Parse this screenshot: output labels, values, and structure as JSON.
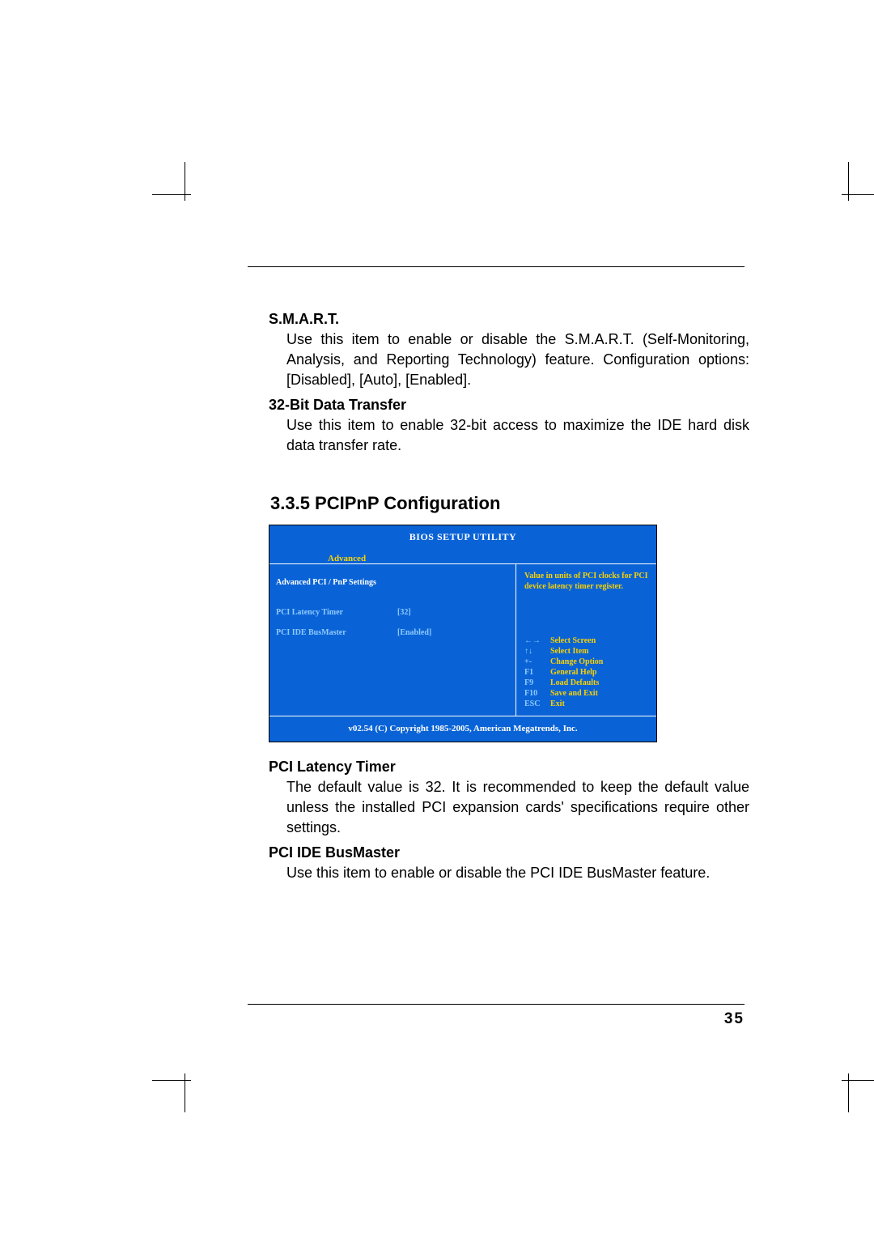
{
  "smart": {
    "title": "S.M.A.R.T.",
    "body": "Use this item to enable or disable the S.M.A.R.T. (Self-Monitoring, Analysis, and Reporting Technology) feature. Configuration options: [Disabled], [Auto], [Enabled]."
  },
  "bit32": {
    "title": "32-Bit Data Transfer",
    "body": "Use this item to enable 32-bit access to maximize the IDE hard disk data transfer rate."
  },
  "section_title": "3.3.5 PCIPnP Configuration",
  "bios": {
    "header": "BIOS SETUP UTILITY",
    "tab": "Advanced",
    "subtitle": "Advanced PCI / PnP Settings",
    "rows": [
      {
        "label": "PCI Latency Timer",
        "value": "[32]"
      },
      {
        "label": "PCI IDE BusMaster",
        "value": "[Enabled]"
      }
    ],
    "help_text": "Value in units of PCI clocks for PCI device latency timer register.",
    "keys": [
      {
        "k": "←→",
        "d": "Select Screen"
      },
      {
        "k": "↑↓",
        "d": "Select Item"
      },
      {
        "k": "+-",
        "d": "Change Option"
      },
      {
        "k": "F1",
        "d": "General Help"
      },
      {
        "k": "F9",
        "d": "Load Defaults"
      },
      {
        "k": "F10",
        "d": "Save and Exit"
      },
      {
        "k": "ESC",
        "d": "Exit"
      }
    ],
    "footer": "v02.54 (C) Copyright 1985-2005, American Megatrends, Inc."
  },
  "pci_latency": {
    "title": "PCI Latency Timer",
    "body": "The default value is 32. It is recommended to keep the default value unless the installed PCI expansion cards' specifications require other settings."
  },
  "pci_ide": {
    "title": "PCI IDE BusMaster",
    "body": "Use this item to enable or disable the PCI IDE BusMaster feature."
  },
  "page_number": "35"
}
